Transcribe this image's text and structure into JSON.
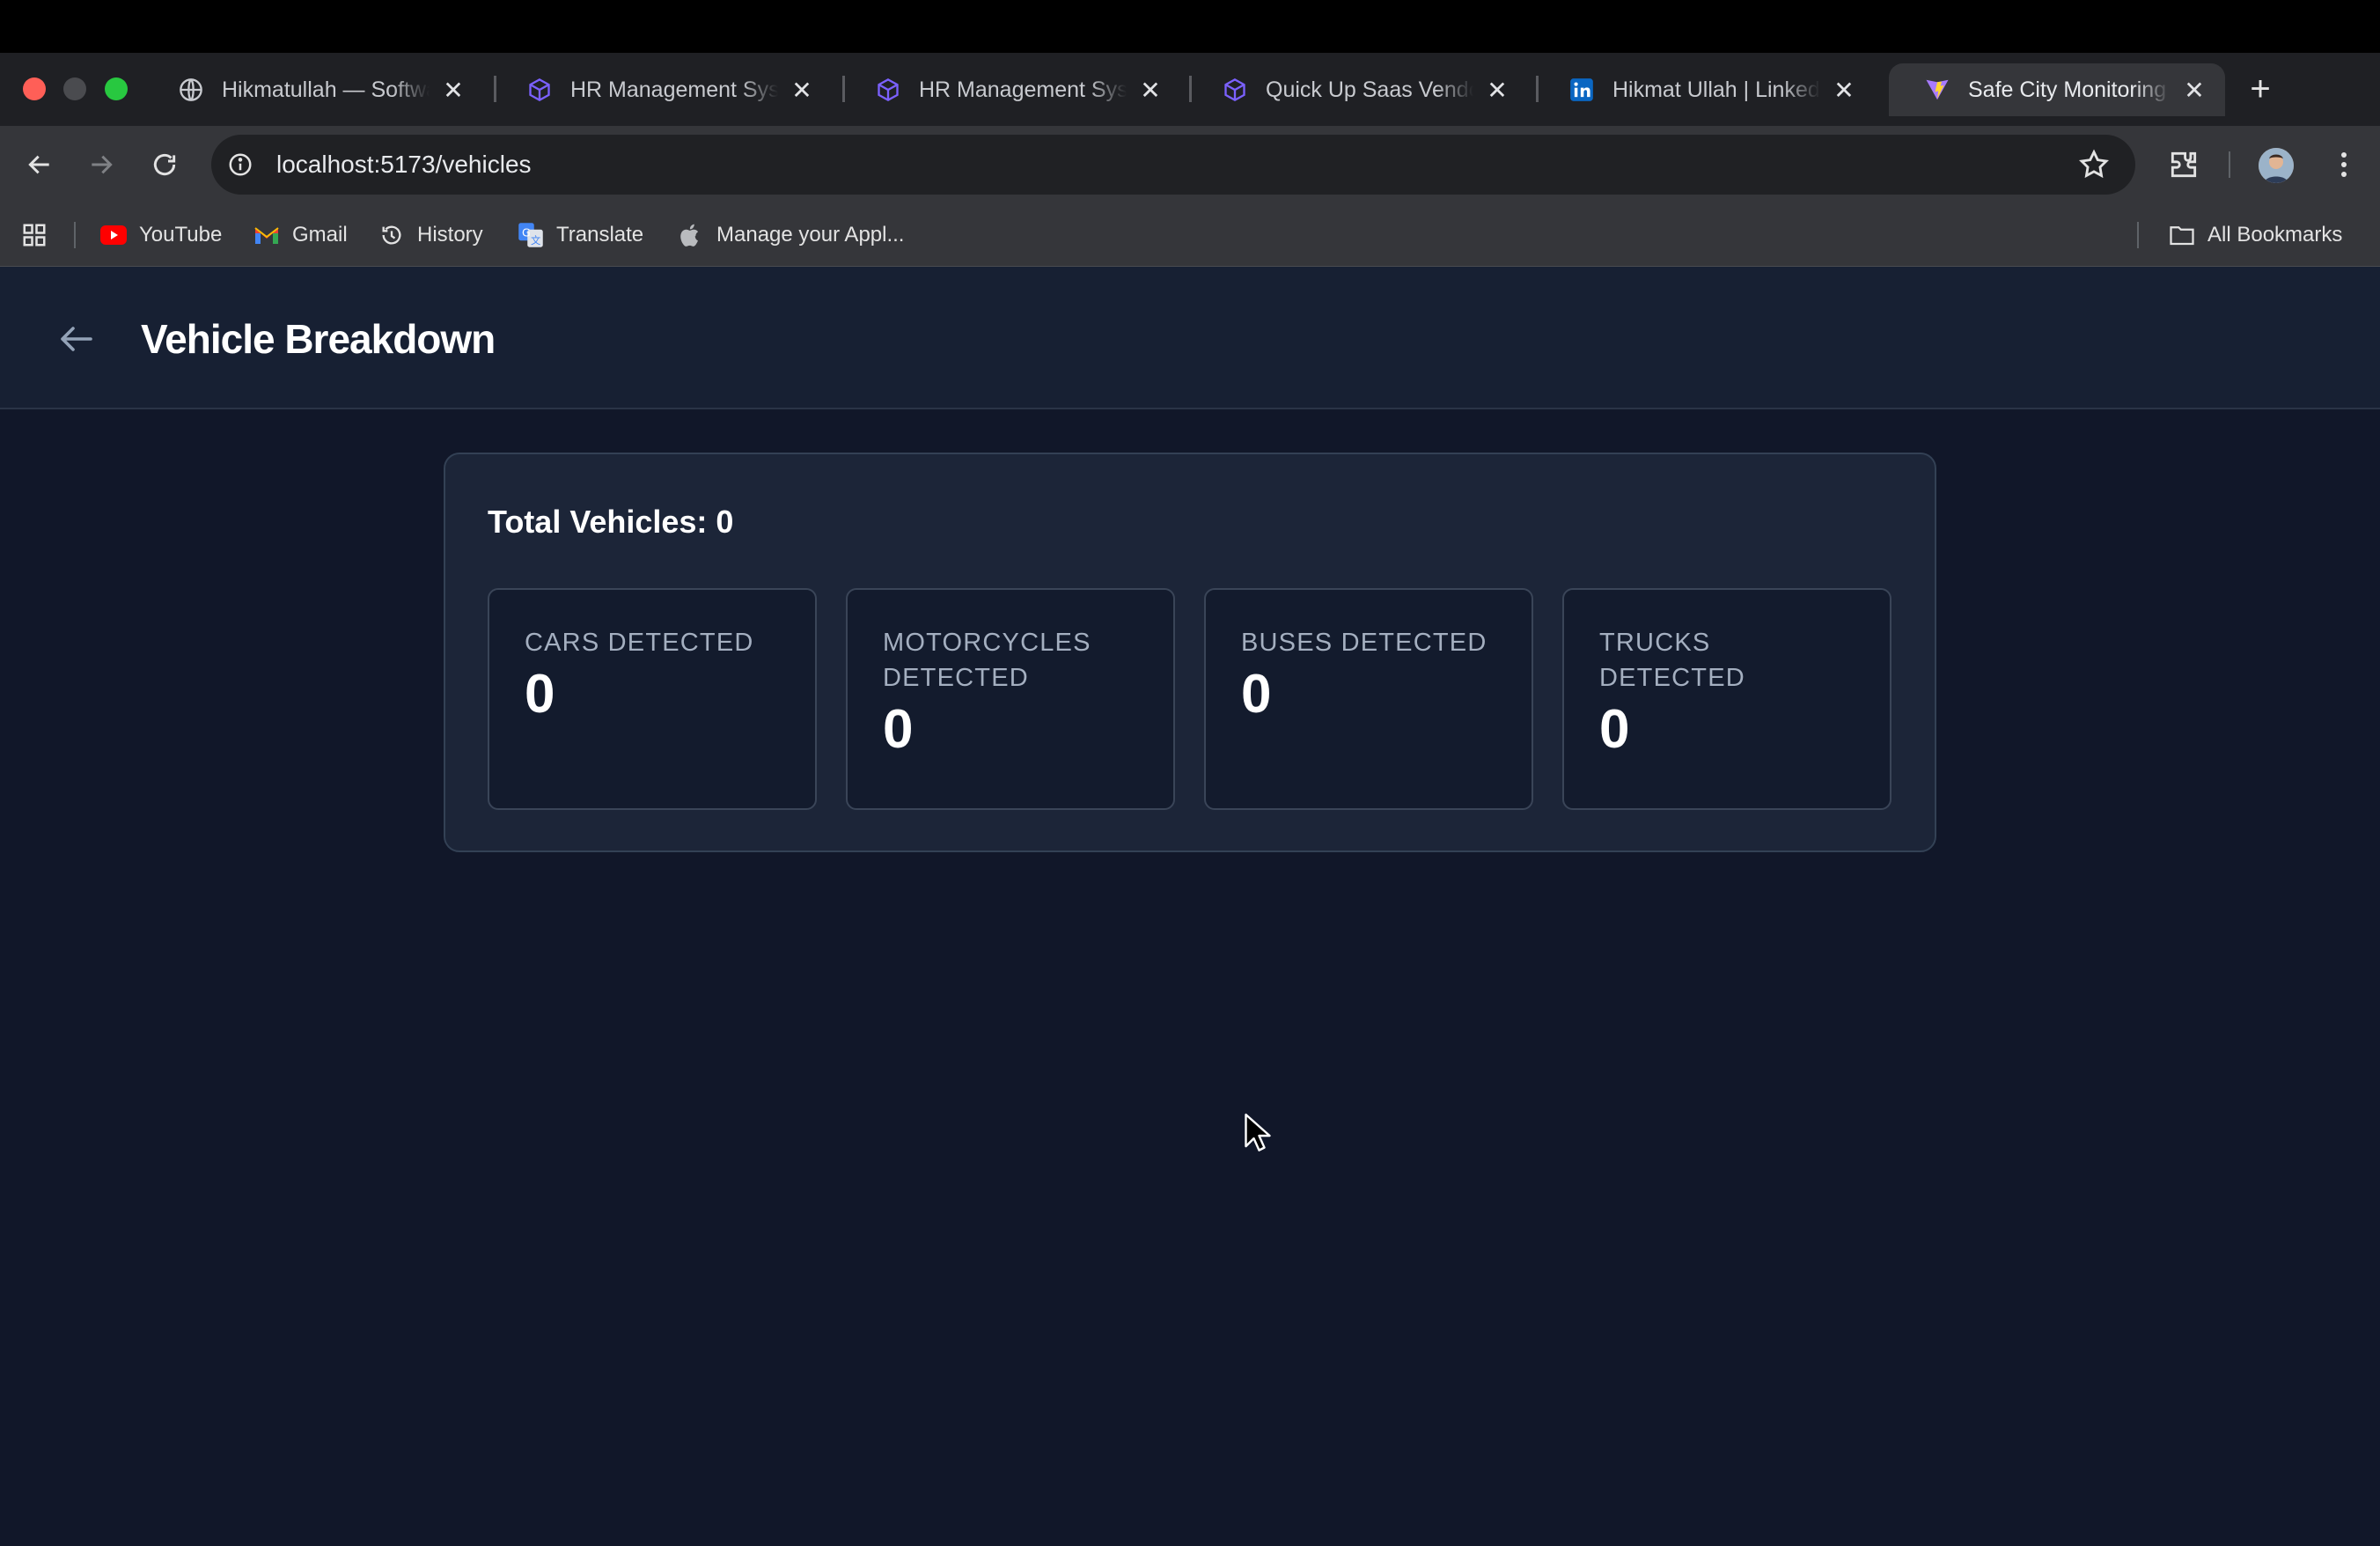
{
  "browser": {
    "tabs": [
      {
        "title": "Hikmatullah — Software Engineer",
        "icon": "globe-icon"
      },
      {
        "title": "HR Management System",
        "icon": "cube-icon"
      },
      {
        "title": "HR Management System",
        "icon": "cube-icon"
      },
      {
        "title": "Quick Up Saas Vendor",
        "icon": "cube-icon"
      },
      {
        "title": "Hikmat Ullah | LinkedIn",
        "icon": "linkedin-icon"
      },
      {
        "title": "Safe City Monitoring Dashboard",
        "icon": "vite-icon",
        "active": true
      }
    ],
    "url": "localhost:5173/vehicles",
    "bookmarks": [
      {
        "label": "YouTube",
        "icon": "youtube-icon"
      },
      {
        "label": "Gmail",
        "icon": "gmail-icon"
      },
      {
        "label": "History",
        "icon": "history-icon"
      },
      {
        "label": "Translate",
        "icon": "translate-icon"
      },
      {
        "label": "Manage your Appl...",
        "icon": "apple-icon"
      }
    ],
    "all_bookmarks_label": "All Bookmarks"
  },
  "page": {
    "title": "Vehicle Breakdown",
    "total_label": "Total Vehicles: 0",
    "cards": [
      {
        "label": "CARS DETECTED",
        "value": "0"
      },
      {
        "label": "MOTORCYCLES DETECTED",
        "value": "0"
      },
      {
        "label": "BUSES DETECTED",
        "value": "0"
      },
      {
        "label": "TRUCKS DETECTED",
        "value": "0"
      }
    ]
  },
  "colors": {
    "page_background": "#111729",
    "header_background": "#172033",
    "panel_background": "#1c2538",
    "card_background": "#131b2d",
    "label_text": "#a4afc0"
  }
}
